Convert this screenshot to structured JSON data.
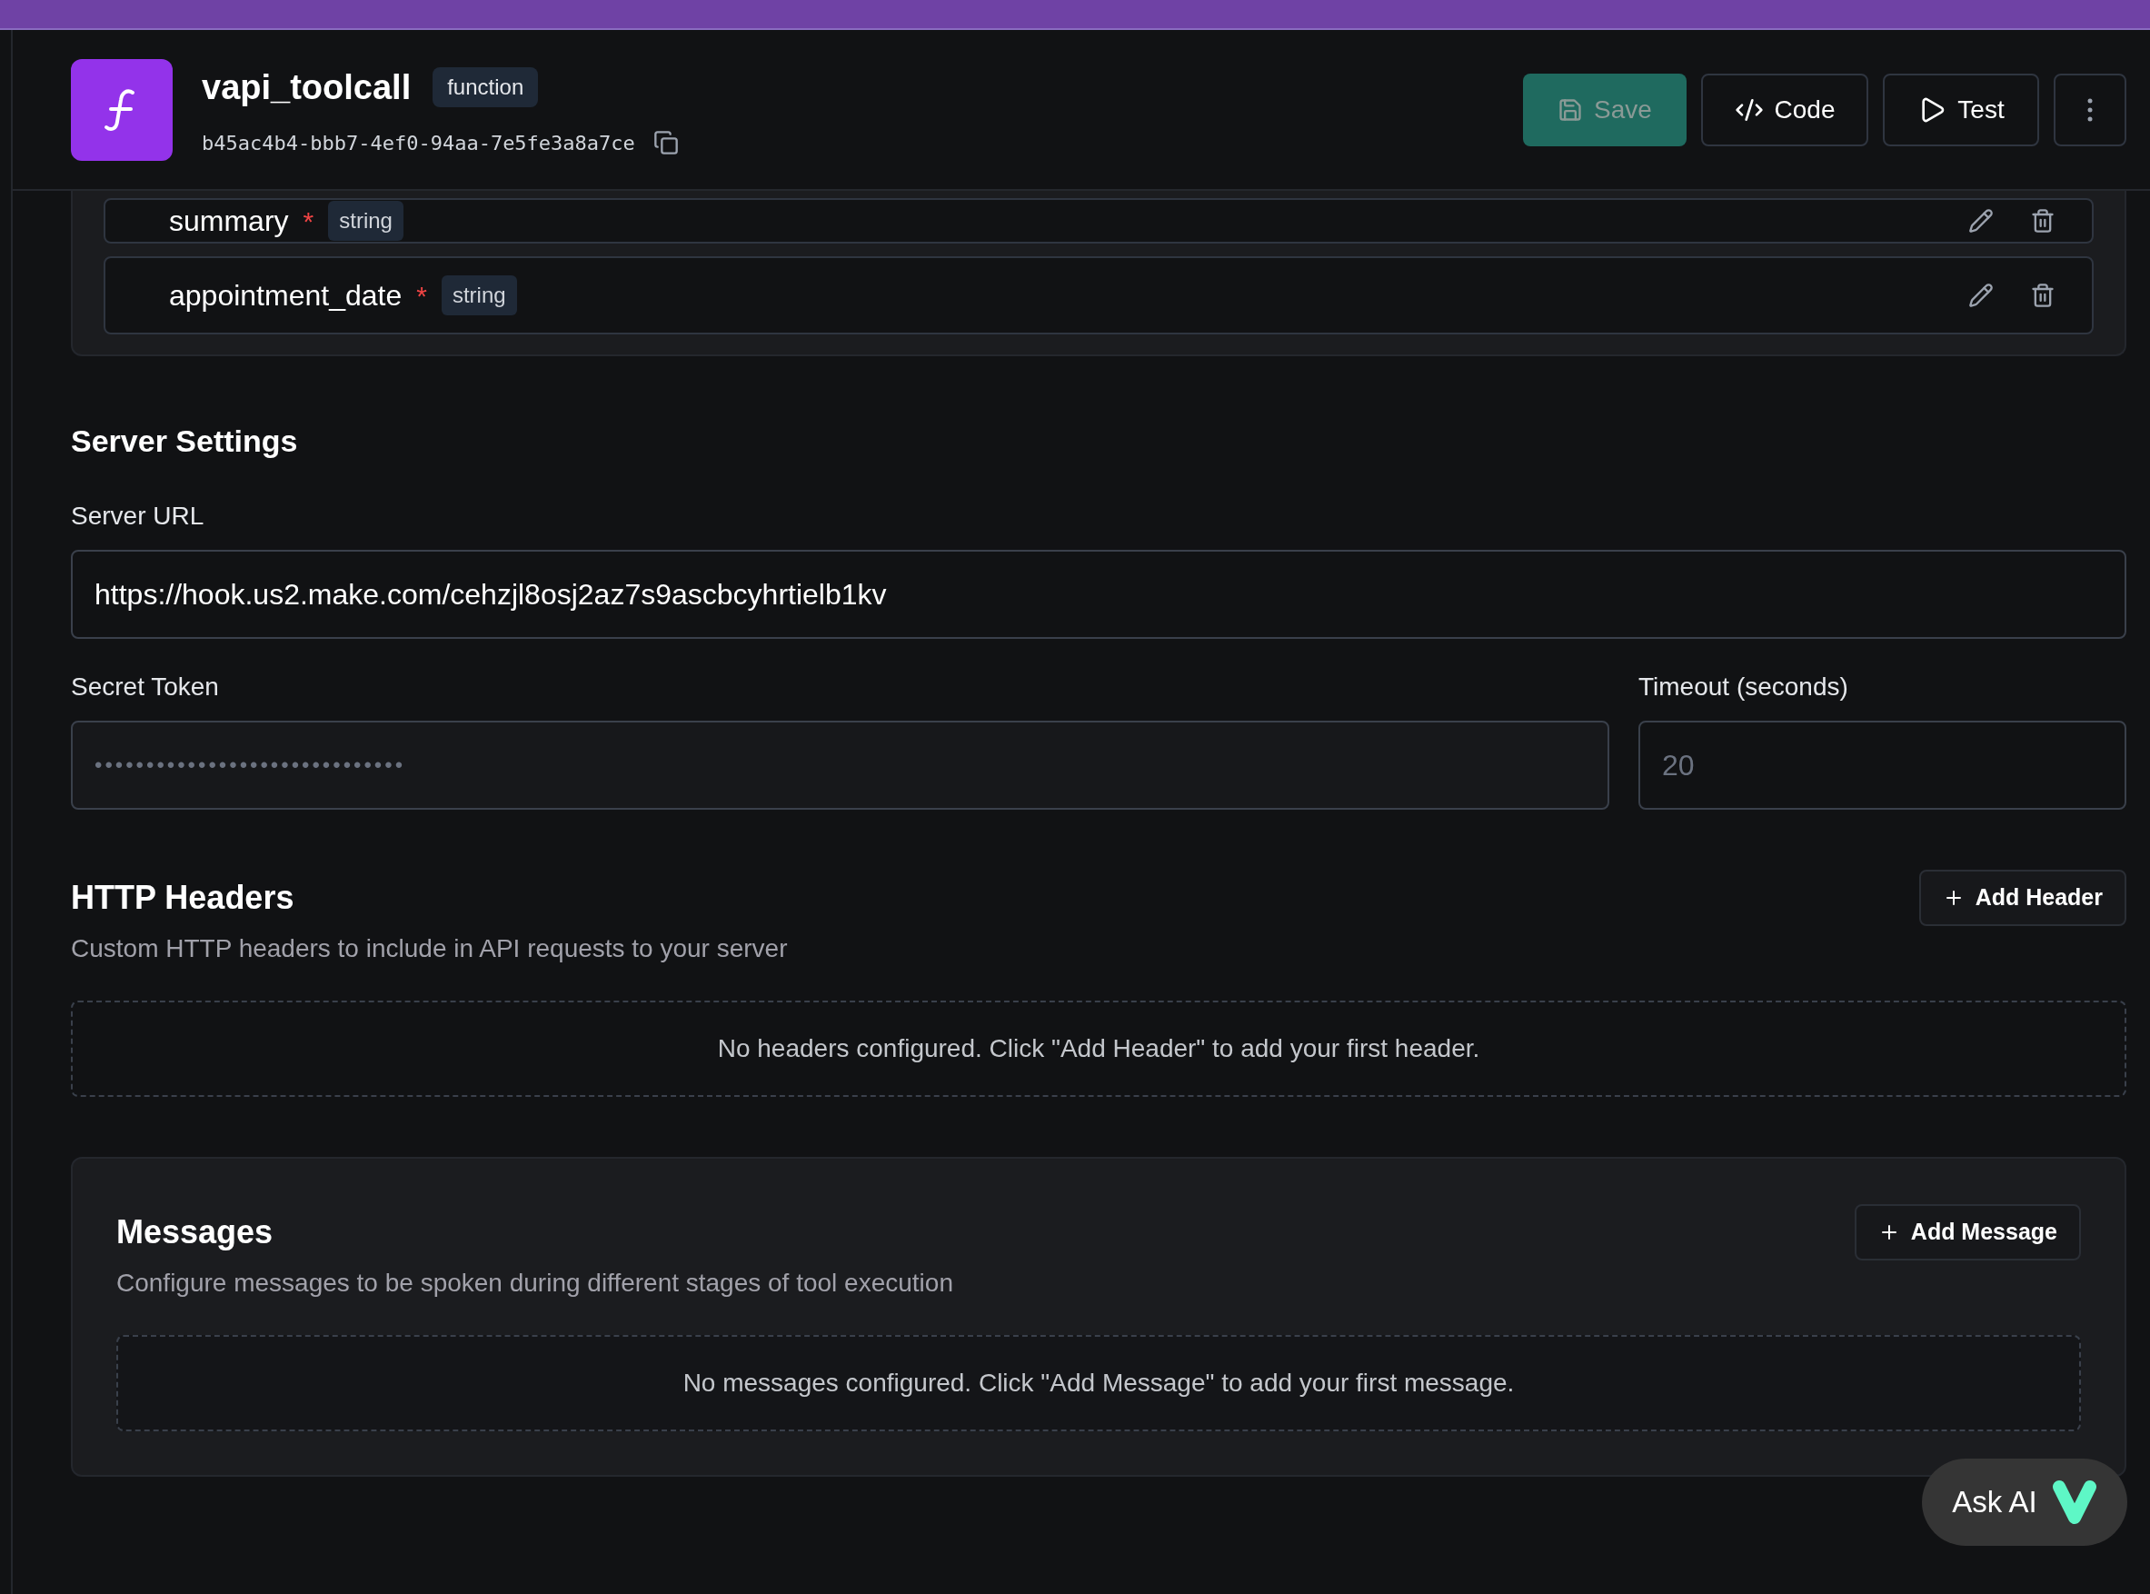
{
  "tool": {
    "name": "vapi_toolcall",
    "type_badge": "function",
    "id": "b45ac4b4-bbb7-4ef0-94aa-7e5fe3a8a7ce"
  },
  "actions": [
    {
      "kind": "save",
      "label": "Save",
      "disabled": true
    },
    {
      "kind": "code",
      "label": "Code",
      "disabled": false
    },
    {
      "kind": "test",
      "label": "Test",
      "disabled": false
    },
    {
      "kind": "more",
      "disabled": false
    }
  ],
  "parameters": [
    {
      "name": "summary",
      "required_mark": "*",
      "type": "string"
    },
    {
      "name": "appointment_date",
      "required_mark": "*",
      "type": "string"
    }
  ],
  "server_settings": {
    "title": "Server Settings",
    "url_label": "Server URL",
    "url_value": "https://hook.us2.make.com/cehzjl8osj2az7s9ascbcyhrtielb1kv",
    "secret_label": "Secret Token",
    "secret_value": "••••••••••••••••••••••••••••••",
    "timeout_label": "Timeout (seconds)",
    "timeout_placeholder": "20"
  },
  "headers": {
    "title": "HTTP Headers",
    "add_label": "Add Header",
    "description": "Custom HTTP headers to include in API requests to your server",
    "empty": "No headers configured. Click \"Add Header\" to add your first header."
  },
  "messages": {
    "title": "Messages",
    "add_label": "Add Message",
    "description": "Configure messages to be spoken during different stages of tool execution",
    "empty": "No messages configured. Click \"Add Message\" to add your first message."
  },
  "ask_ai": {
    "label": "Ask AI"
  }
}
